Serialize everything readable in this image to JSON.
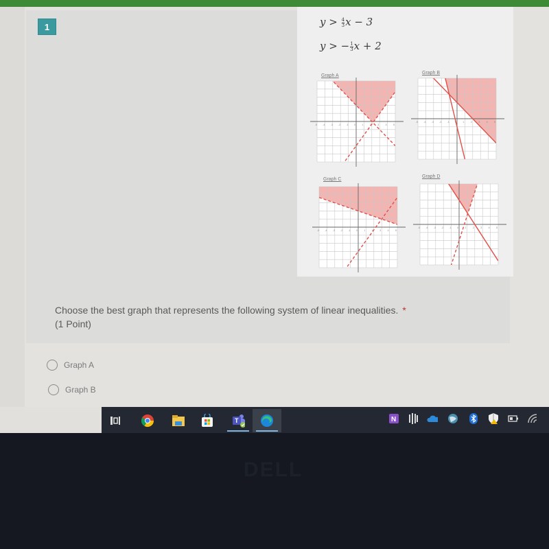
{
  "question": {
    "number": "1",
    "prompt": "Choose the best graph that represents the following system of linear inequalities.",
    "required_marker": "*",
    "points": "(1 Point)",
    "inequalities": [
      {
        "lhs": "y",
        "op": ">",
        "sign": "",
        "num": "4",
        "den": "3",
        "rest": "x − 3"
      },
      {
        "lhs": "y",
        "op": ">",
        "sign": "−",
        "num": "1",
        "den": "3",
        "rest": "x + 2"
      }
    ],
    "options": [
      {
        "label": "Graph A",
        "selected": false
      },
      {
        "label": "Graph B",
        "selected": false
      }
    ]
  },
  "graphs": [
    {
      "title": "Graph A",
      "line1": {
        "m": 1.3333,
        "b": -3,
        "style": "dashed"
      },
      "line2": {
        "m": -1,
        "b": 2,
        "style": "dashed"
      },
      "shade": "right-of-steep-and-above-other"
    },
    {
      "title": "Graph B",
      "line1": {
        "m": -4,
        "b": -1,
        "style": "solid"
      },
      "line2": {
        "m": -1,
        "b": 2,
        "style": "solid"
      },
      "shade": "above-both"
    },
    {
      "title": "Graph C",
      "line1": {
        "m": 1.3333,
        "b": -3,
        "style": "dashed"
      },
      "line2": {
        "m": -0.3333,
        "b": 2,
        "style": "dashed"
      },
      "shade": "above-flat-line-only"
    },
    {
      "title": "Graph D",
      "line1": {
        "m": 3,
        "b": -2,
        "style": "dashed"
      },
      "line2": {
        "m": -1.5,
        "b": 3,
        "style": "solid"
      },
      "shade": "above-both-wedge"
    }
  ],
  "graph_axis": {
    "x_ticks": [
      "-5",
      "-4",
      "-3",
      "-2",
      "-1",
      "0",
      "1",
      "2",
      "3",
      "4",
      "5"
    ],
    "y_range": [
      -5,
      5
    ]
  },
  "colors": {
    "accent_green": "#3f8a36",
    "badge_teal": "#3a9aa0",
    "shade_red": "#f0a8a4",
    "line_red": "#e0504a"
  },
  "taskbar": {
    "apps": [
      {
        "name": "task-view",
        "active": false
      },
      {
        "name": "chrome",
        "active": false
      },
      {
        "name": "file-explorer",
        "active": false
      },
      {
        "name": "microsoft-store",
        "active": false
      },
      {
        "name": "teams",
        "active": true
      },
      {
        "name": "edge",
        "active": true
      }
    ],
    "tray": [
      "onenote",
      "audio-app",
      "onedrive",
      "vpn-globe",
      "bluetooth",
      "security-shield",
      "battery",
      "wifi"
    ]
  },
  "bezel": {
    "brand": "DELL"
  }
}
